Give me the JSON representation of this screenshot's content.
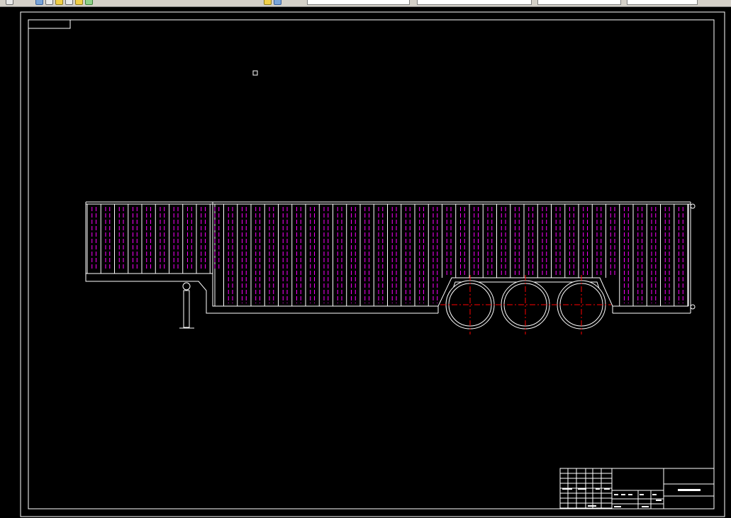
{
  "toolbar": {
    "combo_1": "",
    "combo_2": "",
    "combo_3": "",
    "combo_4": ""
  },
  "drawing": {
    "title_text": "",
    "panel_count": 44,
    "axle_count": 3
  },
  "colors": {
    "line": "#ffffff",
    "panel_dash": "#ff00ff",
    "centerline": "#ff0000",
    "background": "#000000"
  }
}
